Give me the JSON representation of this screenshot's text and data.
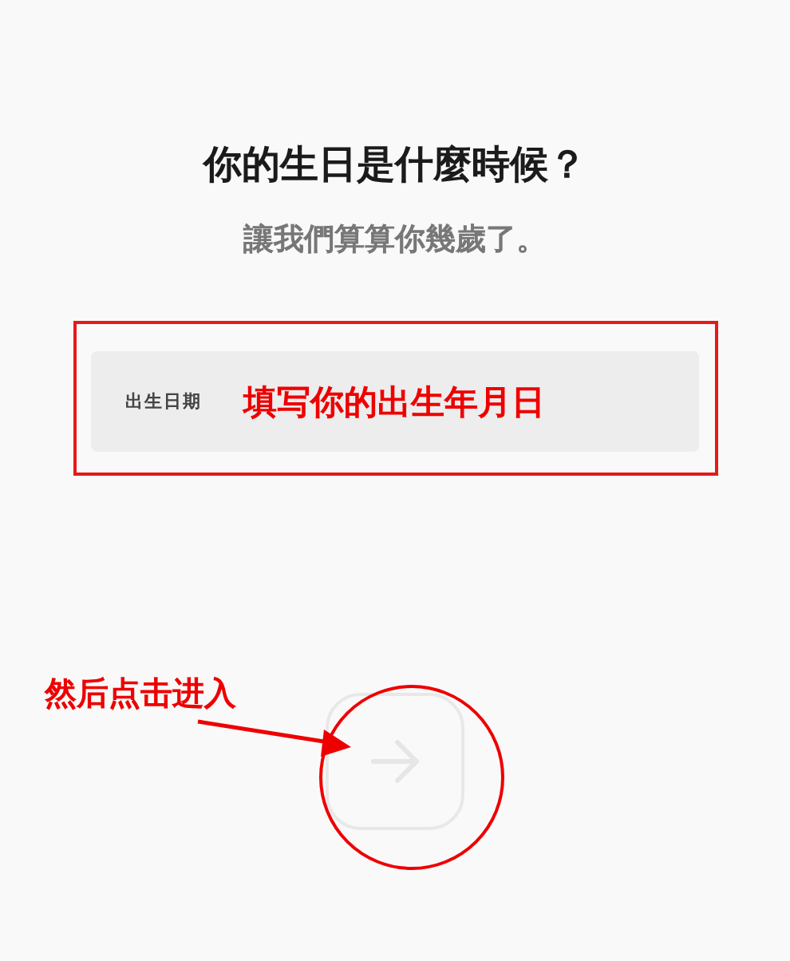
{
  "title": "你的生日是什麼時候？",
  "subtitle": "讓我們算算你幾歲了。",
  "birthday_field": {
    "label": "出生日期"
  },
  "next_button": {
    "disabled": true
  },
  "annotations": {
    "field_note": "填写你的出生年月日",
    "button_note": "然后点击进入"
  }
}
